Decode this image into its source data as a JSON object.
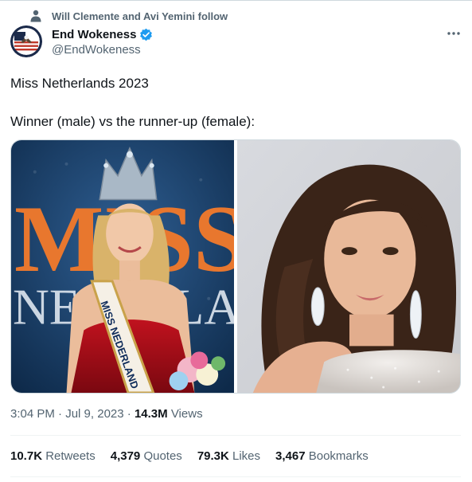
{
  "social_context": {
    "text": "Will Clemente and Avi Yemini follow"
  },
  "author": {
    "name": "End Wokeness",
    "handle": "@EndWokeness",
    "verified": true,
    "verified_color": "#1d9bf0"
  },
  "tweet": {
    "text_line1": "Miss Netherlands 2023",
    "text_line2": "Winner (male) vs the runner-up (female):",
    "media": [
      {
        "photo_name": "winner-photo",
        "sash_text": "MISS NEDERLAND",
        "backdrop_text": "MISS"
      },
      {
        "photo_name": "runner-up-photo"
      }
    ]
  },
  "meta": {
    "time": "3:04 PM",
    "sep1": " · ",
    "date": "Jul 9, 2023",
    "sep2": " · ",
    "views_count": "14.3M",
    "views_label": " Views"
  },
  "stats": [
    {
      "count": "10.7K",
      "label": " Retweets"
    },
    {
      "count": "4,379",
      "label": " Quotes"
    },
    {
      "count": "79.3K",
      "label": " Likes"
    },
    {
      "count": "3,467",
      "label": " Bookmarks"
    }
  ],
  "colors": {
    "text": "#0f1419",
    "secondary": "#536471",
    "accent": "#1d9bf0",
    "border": "#cfd9de"
  },
  "icons": {
    "social": "person-icon",
    "verified": "verified-badge-icon",
    "more": "more-dots-icon"
  }
}
